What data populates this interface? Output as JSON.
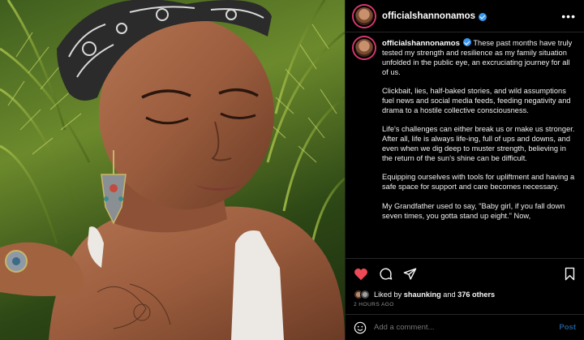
{
  "post": {
    "username": "officialshannonamos",
    "caption": [
      "These past months have truly tested my strength and resilience as my family situation unfolded in the public eye, an excruciating journey for all of us.",
      "Clickbait, lies, half-baked stories, and wild assumptions fuel news and social media feeds, feeding negativity and drama to a hostile collective consciousness.",
      "Life's challenges can either break us or make us stronger. After all, life is always life-ing, full of ups and downs, and even when we dig deep to muster strength, believing in the return of the sun's shine can be difficult.",
      "Equipping ourselves with tools for upliftment and having a safe space for support and care becomes necessary.",
      "My Grandfather used to say, \"Baby girl, if you fall down seven times, you gotta stand up eight.\" Now,"
    ],
    "liked_by_prefix": "Liked by ",
    "liked_by_user": "shaunking",
    "liked_by_and": " and ",
    "others_count": "376 others",
    "timestamp": "2 HOURS AGO"
  },
  "comment": {
    "placeholder": "Add a comment...",
    "post_label": "Post"
  },
  "icons": {
    "more": "more-options-icon",
    "like": "heart-icon",
    "comment": "comment-icon",
    "share": "share-icon",
    "save": "bookmark-icon",
    "emoji": "emoji-icon",
    "verified": "verified-badge-icon"
  },
  "colors": {
    "like_active": "#ed4956",
    "verified": "#3897f0",
    "story_ring": "#d9376e",
    "muted_text": "#8e8e8e",
    "post_button": "#1f5b8f"
  }
}
